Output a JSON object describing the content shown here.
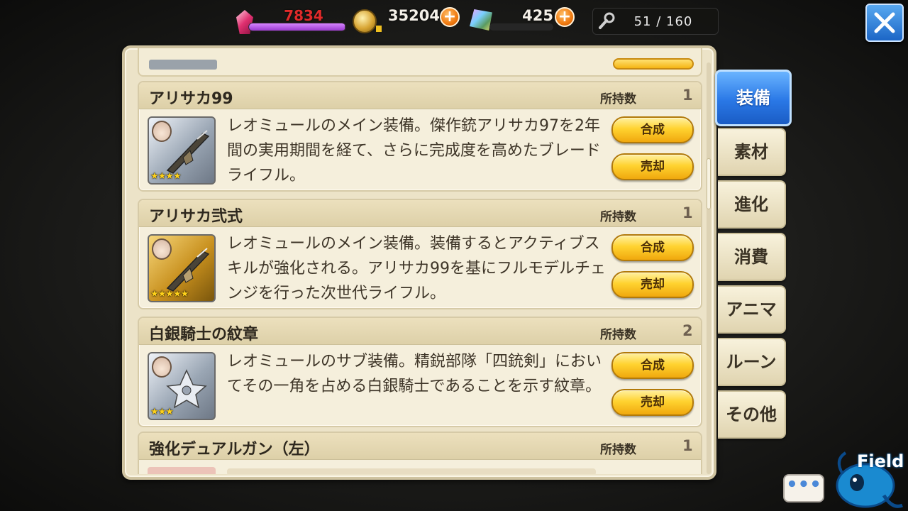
{
  "topbar": {
    "stamina_value": "7834",
    "stamina_fraction": 0.99,
    "gold_value": "35204",
    "gem_value": "425",
    "plus_symbol": "+",
    "inventory_value": "51 / 160",
    "icons": [
      "crystal-icon",
      "gold-coin-icon",
      "gem-icon",
      "wrench-icon",
      "close-icon"
    ]
  },
  "items": [
    {
      "name": "アリサカ99",
      "own_label": "所持数",
      "own_count": "1",
      "stars": "★★★★",
      "rarity": "silver",
      "desc": "レオミュールのメイン装備。傑作銃アリサカ97を2年間の実用期間を経て、さらに完成度を高めたブレードライフル。",
      "combine_label": "合成",
      "sell_label": "売却"
    },
    {
      "name": "アリサカ弐式",
      "own_label": "所持数",
      "own_count": "1",
      "stars": "★★★★★",
      "rarity": "gold",
      "desc": "レオミュールのメイン装備。装備するとアクティブスキルが強化される。アリサカ99を基にフルモデルチェンジを行った次世代ライフル。",
      "combine_label": "合成",
      "sell_label": "売却"
    },
    {
      "name": "白銀騎士の紋章",
      "own_label": "所持数",
      "own_count": "2",
      "stars": "★★★",
      "rarity": "silver",
      "desc": "レオミュールのサブ装備。精鋭部隊「四銃剣」においてその一角を占める白銀騎士であることを示す紋章。",
      "combine_label": "合成",
      "sell_label": "売却"
    },
    {
      "name": "強化デュアルガン（左）",
      "own_label": "所持数",
      "own_count": "1"
    }
  ],
  "tabs": [
    "装備",
    "素材",
    "進化",
    "消費",
    "アニマ",
    "ルーン",
    "その他"
  ],
  "active_tab": "装備",
  "chat_label": "•••",
  "field_label": "Field",
  "colors": {
    "accent_blue": "#2a78e6",
    "button_gold": "#ffd330",
    "stamina_red": "#e02a2a",
    "panel_bg": "#ece3c8"
  }
}
